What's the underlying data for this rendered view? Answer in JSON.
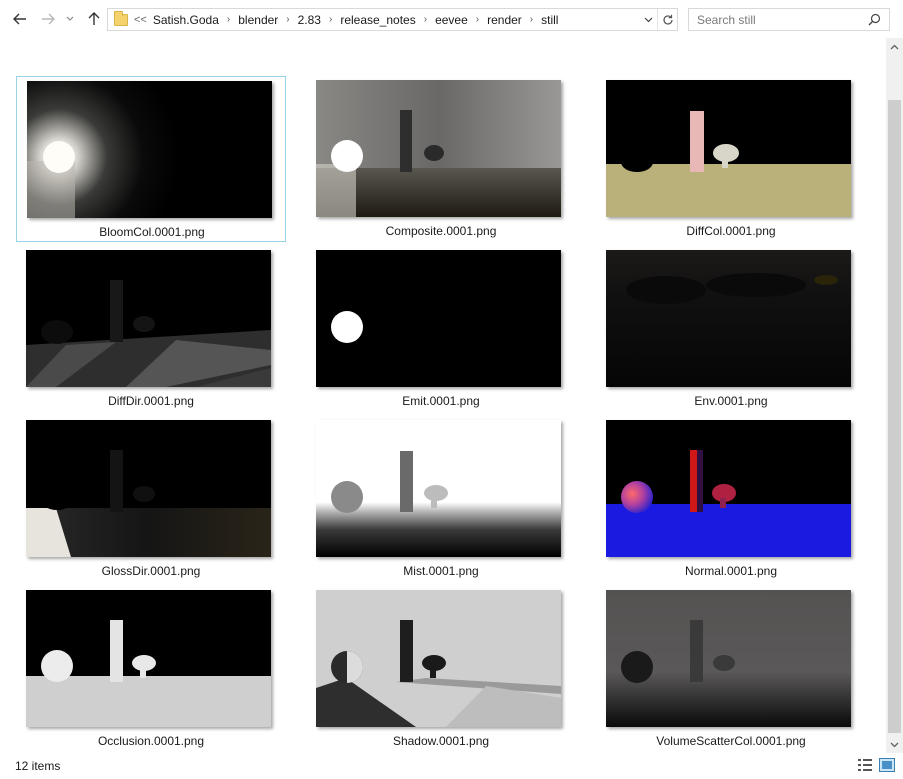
{
  "toolbar": {
    "back_icon": "arrow-left-icon",
    "forward_icon": "arrow-right-icon",
    "recent_icon": "chevron-down-icon",
    "up_icon": "arrow-up-icon"
  },
  "address": {
    "overflow": "<<",
    "crumbs": [
      "Satish.Goda",
      "blender",
      "2.83",
      "release_notes",
      "eevee",
      "render",
      "still"
    ],
    "separator": "›"
  },
  "search": {
    "placeholder": "Search still"
  },
  "files": [
    {
      "name": "BloomCol.0001.png",
      "selected": true
    },
    {
      "name": "Composite.0001.png",
      "selected": false
    },
    {
      "name": "DiffCol.0001.png",
      "selected": false
    },
    {
      "name": "DiffDir.0001.png",
      "selected": false
    },
    {
      "name": "Emit.0001.png",
      "selected": false
    },
    {
      "name": "Env.0001.png",
      "selected": false
    },
    {
      "name": "GlossDir.0001.png",
      "selected": false
    },
    {
      "name": "Mist.0001.png",
      "selected": false
    },
    {
      "name": "Normal.0001.png",
      "selected": false
    },
    {
      "name": "Occlusion.0001.png",
      "selected": false
    },
    {
      "name": "Shadow.0001.png",
      "selected": false
    },
    {
      "name": "VolumeScatterCol.0001.png",
      "selected": false
    }
  ],
  "status": {
    "item_count": "12 items"
  },
  "colors": {
    "selection_border": "#99d1e8",
    "scrollbar_thumb": "#cdcdcd"
  }
}
